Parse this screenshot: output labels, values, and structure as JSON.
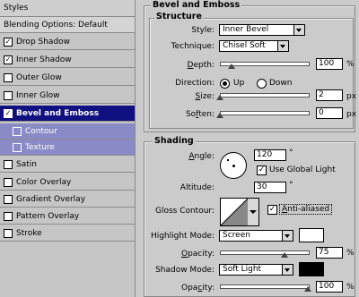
{
  "left_panel": {
    "header": "Styles",
    "blending": "Blending Options: Default",
    "items": [
      {
        "label": "Drop Shadow",
        "checked": true
      },
      {
        "label": "Inner Shadow",
        "checked": true
      },
      {
        "label": "Outer Glow",
        "checked": false
      },
      {
        "label": "Inner Glow",
        "checked": false
      },
      {
        "label": "Bevel and Emboss",
        "checked": true
      },
      {
        "label": "Contour",
        "checked": false
      },
      {
        "label": "Texture",
        "checked": false
      },
      {
        "label": "Satin",
        "checked": false
      },
      {
        "label": "Color Overlay",
        "checked": false
      },
      {
        "label": "Gradient Overlay",
        "checked": false
      },
      {
        "label": "Pattern Overlay",
        "checked": false
      },
      {
        "label": "Stroke",
        "checked": false
      }
    ]
  },
  "bevel": {
    "title": "Bevel and Emboss",
    "structure_title": "Structure",
    "style_label": "Style:",
    "style_value": "Inner Bevel",
    "technique_label": "Technique:",
    "technique_value": "Chisel Soft",
    "depth_label": "Depth:",
    "depth_value": "100",
    "depth_unit": "%",
    "direction_label": "Direction:",
    "dir_up": "Up",
    "dir_down": "Down",
    "size_label": "Size:",
    "size_value": "2",
    "size_unit": "px",
    "soften_label": "Soften:",
    "soften_value": "0",
    "soften_unit": "px"
  },
  "shading": {
    "title": "Shading",
    "angle_label": "Angle:",
    "angle_value": "120",
    "deg": "°",
    "global_light": "Use Global Light",
    "altitude_label": "Altitude:",
    "altitude_value": "30",
    "gloss_label": "Gloss Contour:",
    "anti_aliased": "Anti-aliased",
    "highlight_label": "Highlight Mode:",
    "highlight_value": "Screen",
    "highlight_opacity_label": "Opacity:",
    "highlight_opacity": "75",
    "opacity_unit": "%",
    "shadow_label": "Shadow Mode:",
    "shadow_value": "Soft Light",
    "shadow_opacity_label": "Opacity:",
    "shadow_opacity": "100",
    "highlight_color": "#ffffff",
    "shadow_color": "#000000"
  }
}
